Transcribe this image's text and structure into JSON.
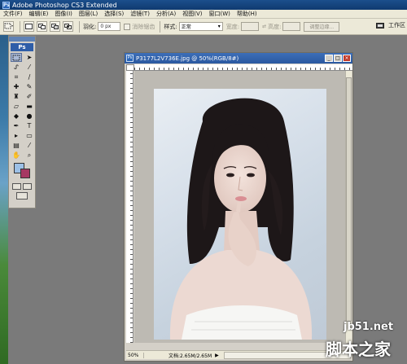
{
  "app": {
    "title": "Adobe Photoshop CS3 Extended",
    "ps_badge": "Ps"
  },
  "menu": [
    "文件(F)",
    "编辑(E)",
    "图像(I)",
    "图层(L)",
    "选择(S)",
    "滤镜(T)",
    "分析(A)",
    "视图(V)",
    "窗口(W)",
    "帮助(H)"
  ],
  "options": {
    "feather_label": "羽化:",
    "feather_value": "0 px",
    "antialias_label": "消除锯齿",
    "style_label": "样式:",
    "style_value": "正常",
    "width_label": "宽度:",
    "height_label": "高度:",
    "adjust_edge": "调整边缘...",
    "workspace": "工作区"
  },
  "toolbox": {
    "title": "Ps"
  },
  "document": {
    "title": "P3177L2V736E.jpg @ 50%(RGB/8#)",
    "zoom": "50%",
    "doc_info": "文档:2.65M/2.65M",
    "min_btn": "_",
    "max_btn": "□",
    "close_btn": "×"
  },
  "watermark": {
    "site": "jb51.net",
    "brand": "脚本之家"
  },
  "colors": {
    "foreground": "#9cc0e6",
    "background": "#a63862"
  }
}
